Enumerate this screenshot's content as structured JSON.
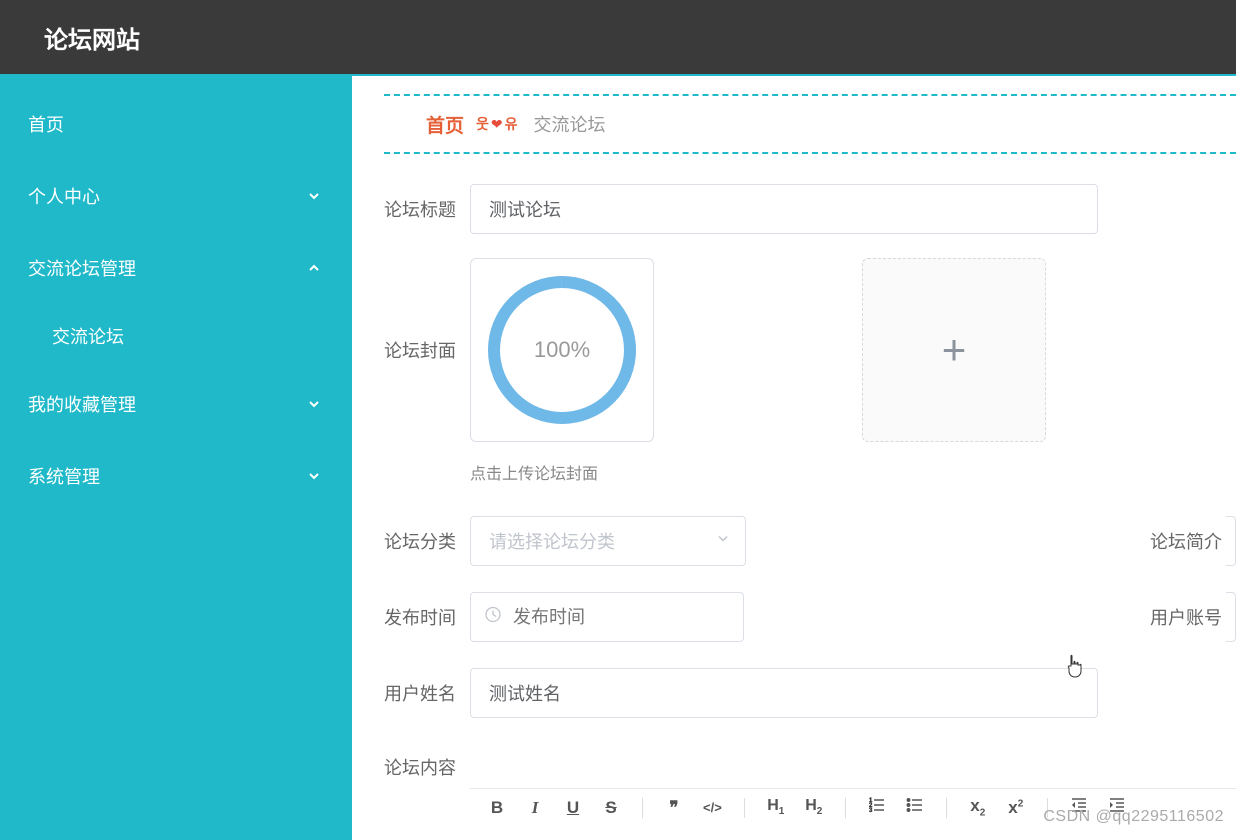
{
  "header": {
    "title": "论坛网站"
  },
  "sidebar": {
    "items": [
      {
        "label": "首页",
        "type": "link"
      },
      {
        "label": "个人中心",
        "type": "submenu",
        "expanded": false
      },
      {
        "label": "交流论坛管理",
        "type": "submenu",
        "expanded": true
      },
      {
        "label": "交流论坛",
        "type": "sub"
      },
      {
        "label": "我的收藏管理",
        "type": "submenu",
        "expanded": false
      },
      {
        "label": "系统管理",
        "type": "submenu",
        "expanded": false
      }
    ]
  },
  "breadcrumb": {
    "home": "首页",
    "sep_left": "웃",
    "sep_heart": "❤",
    "sep_right": "유",
    "current": "交流论坛"
  },
  "form": {
    "title_label": "论坛标题",
    "title_value": "测试论坛",
    "cover_label": "论坛封面",
    "progress_text": "100%",
    "upload_hint": "点击上传论坛封面",
    "category_label": "论坛分类",
    "category_placeholder": "请选择论坛分类",
    "intro_label": "论坛简介",
    "publish_label": "发布时间",
    "publish_placeholder": "发布时间",
    "account_label": "用户账号",
    "username_label": "用户姓名",
    "username_value": "测试姓名",
    "content_label": "论坛内容"
  },
  "editor": {
    "bold": "B",
    "italic": "I",
    "underline": "U",
    "strike": "S",
    "quote": "❞",
    "code": "</>",
    "h1": "H",
    "h1_sub": "1",
    "h2": "H",
    "h2_sub": "2",
    "sub_x": "x",
    "sub_2": "2",
    "sup_x": "x",
    "sup_2": "2"
  },
  "watermark": "CSDN @qq2295116502"
}
